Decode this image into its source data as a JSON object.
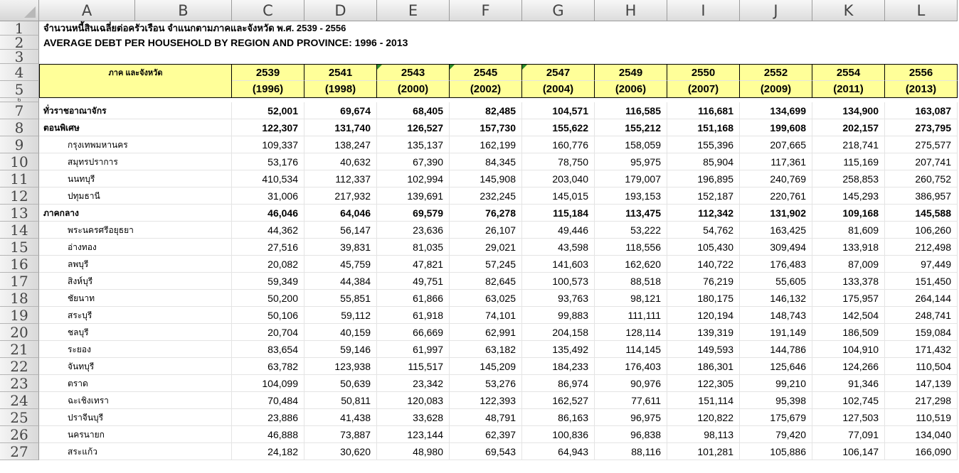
{
  "columns": [
    "A",
    "B",
    "C",
    "D",
    "E",
    "F",
    "G",
    "H",
    "I",
    "J",
    "K",
    "L"
  ],
  "titles": {
    "row1": "จำนวนหนี้สินเฉลี่ยต่อครัวเรือน จำแนกตามภาคและจังหวัด พ.ศ. 2539 - 2556",
    "row2": "AVERAGE DEBT PER HOUSEHOLD BY REGION AND PROVINCE: 1996 - 2013"
  },
  "header": {
    "region_label": "ภาค และจังหวัด",
    "years_th": [
      "2539",
      "2541",
      "2543",
      "2545",
      "2547",
      "2549",
      "2550",
      "2552",
      "2554",
      "2556"
    ],
    "years_en": [
      "(1996)",
      "(1998)",
      "(2000)",
      "(2002)",
      "(2004)",
      "(2006)",
      "(2007)",
      "(2009)",
      "(2011)",
      "(2013)"
    ]
  },
  "row_numbers": [
    "1",
    "2",
    "3",
    "4",
    "5",
    "6",
    "7",
    "8",
    "9",
    "10",
    "11",
    "12",
    "13",
    "14",
    "15",
    "16",
    "17",
    "18",
    "19",
    "20",
    "21",
    "22",
    "23",
    "24",
    "25",
    "26",
    "27"
  ],
  "rows": [
    {
      "label": "ทั่วราชอาณาจักร",
      "bold": true,
      "indent": false,
      "values": [
        "52,001",
        "69,674",
        "68,405",
        "82,485",
        "104,571",
        "116,585",
        "116,681",
        "134,699",
        "134,900",
        "163,087"
      ]
    },
    {
      "label": "ตอนพิเศษ",
      "bold": true,
      "indent": false,
      "values": [
        "122,307",
        "131,740",
        "126,527",
        "157,730",
        "155,622",
        "155,212",
        "151,168",
        "199,608",
        "202,157",
        "273,795"
      ]
    },
    {
      "label": "กรุงเทพมหานคร",
      "bold": false,
      "indent": true,
      "values": [
        "109,337",
        "138,247",
        "135,137",
        "162,199",
        "160,776",
        "158,059",
        "155,396",
        "207,665",
        "218,741",
        "275,577"
      ]
    },
    {
      "label": "สมุทรปราการ",
      "bold": false,
      "indent": true,
      "values": [
        "53,176",
        "40,632",
        "67,390",
        "84,345",
        "78,750",
        "95,975",
        "85,904",
        "117,361",
        "115,169",
        "207,741"
      ]
    },
    {
      "label": "นนทบุรี",
      "bold": false,
      "indent": true,
      "values": [
        "410,534",
        "112,337",
        "102,994",
        "145,908",
        "203,040",
        "179,007",
        "196,895",
        "240,769",
        "258,853",
        "260,752"
      ]
    },
    {
      "label": "ปทุมธานี",
      "bold": false,
      "indent": true,
      "values": [
        "31,006",
        "217,932",
        "139,691",
        "232,245",
        "145,015",
        "193,153",
        "152,187",
        "220,761",
        "145,293",
        "386,957"
      ]
    },
    {
      "label": "ภาคกลาง",
      "bold": true,
      "indent": false,
      "values": [
        "46,046",
        "64,046",
        "69,579",
        "76,278",
        "115,184",
        "113,475",
        "112,342",
        "131,902",
        "109,168",
        "145,588"
      ]
    },
    {
      "label": "พระนครศรีอยุธยา",
      "bold": false,
      "indent": true,
      "values": [
        "44,362",
        "56,147",
        "23,636",
        "26,107",
        "49,446",
        "53,222",
        "54,762",
        "163,425",
        "81,609",
        "106,260"
      ]
    },
    {
      "label": "อ่างทอง",
      "bold": false,
      "indent": true,
      "values": [
        "27,516",
        "39,831",
        "81,035",
        "29,021",
        "43,598",
        "118,556",
        "105,430",
        "309,494",
        "133,918",
        "212,498"
      ]
    },
    {
      "label": "ลพบุรี",
      "bold": false,
      "indent": true,
      "values": [
        "20,082",
        "45,759",
        "47,821",
        "57,245",
        "141,603",
        "162,620",
        "140,722",
        "176,483",
        "87,009",
        "97,449"
      ]
    },
    {
      "label": "สิงห์บุรี",
      "bold": false,
      "indent": true,
      "values": [
        "59,349",
        "44,384",
        "49,751",
        "82,645",
        "100,573",
        "88,518",
        "76,219",
        "55,605",
        "133,378",
        "151,450"
      ]
    },
    {
      "label": "ชัยนาท",
      "bold": false,
      "indent": true,
      "values": [
        "50,200",
        "55,851",
        "61,866",
        "63,025",
        "93,763",
        "98,121",
        "180,175",
        "146,132",
        "175,957",
        "264,144"
      ]
    },
    {
      "label": "สระบุรี",
      "bold": false,
      "indent": true,
      "values": [
        "50,106",
        "59,112",
        "61,918",
        "74,101",
        "99,883",
        "111,111",
        "120,194",
        "148,743",
        "142,504",
        "248,741"
      ]
    },
    {
      "label": "ชลบุรี",
      "bold": false,
      "indent": true,
      "values": [
        "20,704",
        "40,159",
        "66,669",
        "62,991",
        "204,158",
        "128,114",
        "139,319",
        "191,149",
        "186,509",
        "159,084"
      ]
    },
    {
      "label": "ระยอง",
      "bold": false,
      "indent": true,
      "values": [
        "83,654",
        "59,146",
        "61,997",
        "63,182",
        "135,492",
        "114,145",
        "149,593",
        "144,786",
        "104,910",
        "171,432"
      ]
    },
    {
      "label": "จันทบุรี",
      "bold": false,
      "indent": true,
      "values": [
        "63,782",
        "123,938",
        "115,517",
        "145,209",
        "184,233",
        "176,403",
        "186,301",
        "125,646",
        "124,266",
        "110,504"
      ]
    },
    {
      "label": "ตราด",
      "bold": false,
      "indent": true,
      "values": [
        "104,099",
        "50,639",
        "23,342",
        "53,276",
        "86,974",
        "90,976",
        "122,305",
        "99,210",
        "91,346",
        "147,139"
      ]
    },
    {
      "label": "ฉะเชิงเทรา",
      "bold": false,
      "indent": true,
      "values": [
        "70,484",
        "50,811",
        "120,083",
        "122,393",
        "162,527",
        "77,611",
        "151,114",
        "95,398",
        "102,745",
        "217,298"
      ]
    },
    {
      "label": "ปราจีนบุรี",
      "bold": false,
      "indent": true,
      "values": [
        "23,886",
        "41,438",
        "33,628",
        "48,791",
        "86,163",
        "96,975",
        "120,822",
        "175,679",
        "127,503",
        "110,519"
      ]
    },
    {
      "label": "นครนายก",
      "bold": false,
      "indent": true,
      "values": [
        "46,888",
        "73,887",
        "123,144",
        "62,397",
        "100,836",
        "96,838",
        "98,113",
        "79,420",
        "77,091",
        "134,040"
      ]
    },
    {
      "label": "สระแก้ว",
      "bold": false,
      "indent": true,
      "values": [
        "24,182",
        "30,620",
        "48,980",
        "69,543",
        "64,943",
        "88,116",
        "101,281",
        "105,886",
        "106,147",
        "166,090"
      ]
    }
  ]
}
